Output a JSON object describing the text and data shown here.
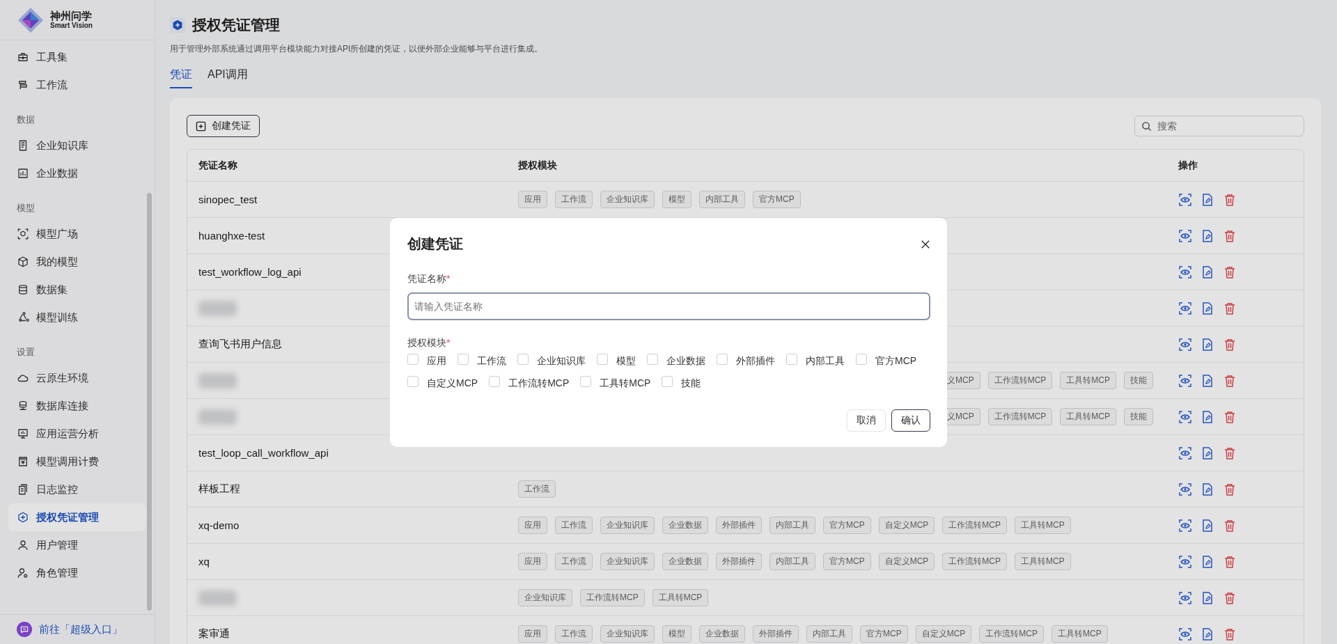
{
  "sidebar": {
    "logo": {
      "name": "神州问学",
      "subtitle": "Smart Vision"
    },
    "groups": [
      {
        "items": [
          {
            "label": "工具集",
            "selected": false
          },
          {
            "label": "工作流",
            "selected": false
          }
        ]
      },
      {
        "label": "数据",
        "items": [
          {
            "label": "企业知识库",
            "selected": false
          },
          {
            "label": "企业数据",
            "selected": false
          }
        ]
      },
      {
        "label": "模型",
        "items": [
          {
            "label": "模型广场",
            "selected": false
          },
          {
            "label": "我的模型",
            "selected": false
          },
          {
            "label": "数据集",
            "selected": false
          },
          {
            "label": "模型训练",
            "selected": false
          }
        ]
      },
      {
        "label": "设置",
        "items": [
          {
            "label": "云原生环境",
            "selected": false
          },
          {
            "label": "数据库连接",
            "selected": false
          },
          {
            "label": "应用运营分析",
            "selected": false
          },
          {
            "label": "模型调用计费",
            "selected": false
          },
          {
            "label": "日志监控",
            "selected": false
          },
          {
            "label": "授权凭证管理",
            "selected": true
          },
          {
            "label": "用户管理",
            "selected": false
          },
          {
            "label": "角色管理",
            "selected": false
          }
        ]
      }
    ],
    "footer_link": "前往「超级入口」"
  },
  "page": {
    "title": "授权凭证管理",
    "description": "用于管理外部系统通过调用平台模块能力对接API所创建的凭证，以便外部企业能够与平台进行集成。",
    "tabs": [
      {
        "label": "凭证",
        "selected": true
      },
      {
        "label": "API调用",
        "selected": false
      }
    ]
  },
  "toolbar": {
    "create_button": "创建凭证",
    "search": {
      "placeholder": "搜索"
    }
  },
  "table": {
    "columns": [
      "凭证名称",
      "授权模块",
      "操作"
    ],
    "rows": [
      {
        "name": "sinopec_test",
        "modules": [
          "应用",
          "工作流",
          "企业知识库",
          "模型",
          "内部工具",
          "官方MCP"
        ]
      },
      {
        "name": "huanghxe-test"
      },
      {
        "name": "test_workflow_log_api"
      },
      {
        "redacted": true
      },
      {
        "name": "查询飞书用户信息"
      },
      {
        "redacted": true,
        "covered": true,
        "modules": [
          "义MCP",
          "工作流转MCP",
          "工具转MCP",
          "技能"
        ]
      },
      {
        "redacted": true,
        "covered": true,
        "modules": [
          "义MCP",
          "工作流转MCP",
          "工具转MCP",
          "技能"
        ]
      },
      {
        "name": "test_loop_call_workflow_api"
      },
      {
        "name": "样板工程",
        "modules": [
          "工作流"
        ]
      },
      {
        "name": "xq-demo",
        "modules": [
          "应用",
          "工作流",
          "企业知识库",
          "企业数据",
          "外部插件",
          "内部工具",
          "官方MCP",
          "自定义MCP",
          "工作流转MCP",
          "工具转MCP"
        ]
      },
      {
        "name": "xq",
        "modules": [
          "应用",
          "工作流",
          "企业知识库",
          "企业数据",
          "外部插件",
          "内部工具",
          "官方MCP",
          "自定义MCP",
          "工作流转MCP",
          "工具转MCP"
        ]
      },
      {
        "redacted": true,
        "modules": [
          "企业知识库",
          "工作流转MCP",
          "工具转MCP"
        ]
      },
      {
        "name": "案审通",
        "modules": [
          "应用",
          "工作流",
          "企业知识库",
          "模型",
          "企业数据",
          "外部插件",
          "内部工具",
          "官方MCP",
          "自定义MCP",
          "工作流转MCP",
          "工具转MCP"
        ]
      }
    ]
  },
  "dialog": {
    "title": "创建凭证",
    "name_field": {
      "label": "凭证名称",
      "mark": "*",
      "placeholder": "请输入凭证名称"
    },
    "modules_field": {
      "label": "授权模块",
      "mark": "*",
      "options": [
        {
          "label": "应用",
          "checked": false
        },
        {
          "label": "工作流",
          "checked": false
        },
        {
          "label": "企业知识库",
          "checked": false
        },
        {
          "label": "模型",
          "checked": false
        },
        {
          "label": "企业数据",
          "checked": false
        },
        {
          "label": "外部插件",
          "checked": false
        },
        {
          "label": "内部工具",
          "checked": false
        },
        {
          "label": "官方MCP",
          "checked": false
        },
        {
          "label": "自定义MCP",
          "checked": false
        },
        {
          "label": "工作流转MCP",
          "checked": false
        },
        {
          "label": "工具转MCP",
          "checked": false
        },
        {
          "label": "技能",
          "checked": false
        }
      ]
    },
    "buttons": {
      "cancel": "取消",
      "confirm": "确认"
    }
  }
}
